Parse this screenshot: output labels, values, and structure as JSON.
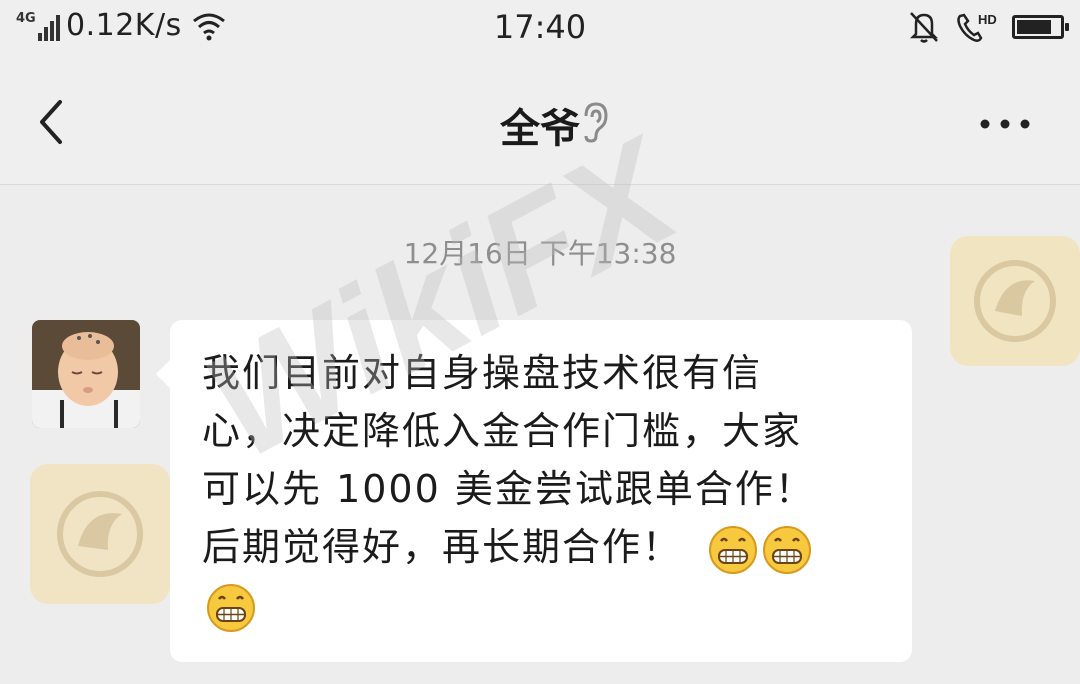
{
  "status_bar": {
    "network": "4G",
    "speed": "0.12K/s",
    "time": "17:40",
    "icons": [
      "signal-icon",
      "wifi-icon",
      "mute-bell-icon",
      "hd-call-icon",
      "battery-icon"
    ],
    "battery_level": 0.85
  },
  "nav": {
    "title": "全爷",
    "icons": [
      "back-chevron-icon",
      "ear-icon",
      "more-dots-icon"
    ]
  },
  "chat": {
    "timestamp": "12月16日 下午13:38",
    "message": {
      "lines": [
        "我们目前对自身操盘技术很有信",
        "心，决定降低入金合作门槛，大家",
        "可以先 1000 美金尝试跟单合作！",
        "后期觉得好，再长期合作！"
      ],
      "emoji": "grinning-face-icon",
      "emoji_count": 3
    }
  },
  "watermark": {
    "text": "WikiFX"
  },
  "colors": {
    "background": "#ededed",
    "bubble": "#ffffff",
    "text": "#1b1b1b",
    "timestamp": "#8e8e8e",
    "watermark_logo": "#f1dfae"
  }
}
